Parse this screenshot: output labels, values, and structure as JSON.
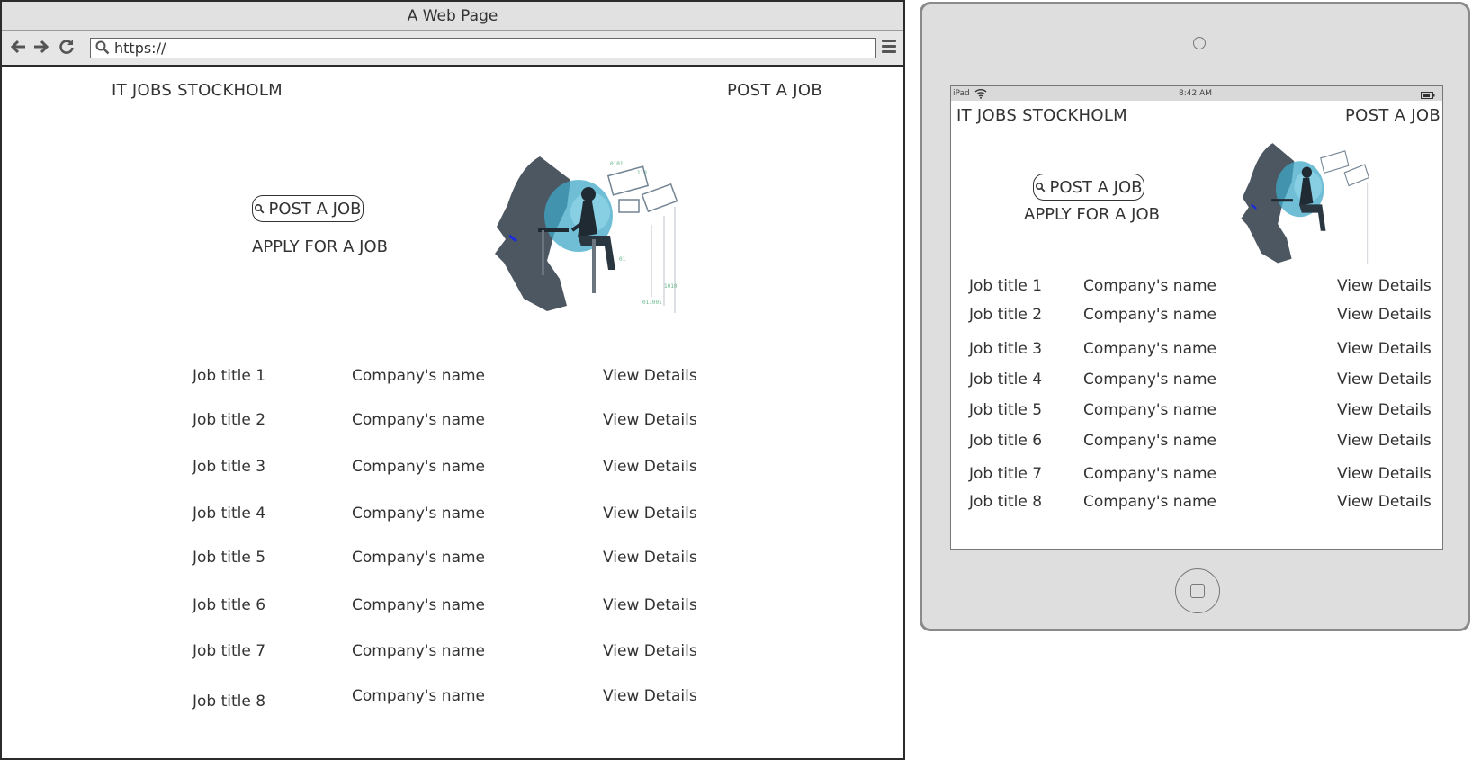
{
  "browser": {
    "window_title": "A Web Page",
    "url": "https://",
    "icons": [
      "back-icon",
      "forward-icon",
      "reload-icon",
      "search-icon",
      "menu-icon"
    ]
  },
  "desktop": {
    "site_title": "IT JOBS STOCKHOLM",
    "nav_post_job": "POST A JOB",
    "hero_post_button": "POST A JOB",
    "hero_apply_link": "APPLY FOR A JOB",
    "jobs": [
      {
        "title": "Job title 1",
        "company": "Company's name",
        "action": "View Details"
      },
      {
        "title": "Job title 2",
        "company": "Company's name",
        "action": "View Details"
      },
      {
        "title": "Job title 3",
        "company": "Company's name",
        "action": "View Details"
      },
      {
        "title": "Job title 4",
        "company": "Company's name",
        "action": "View Details"
      },
      {
        "title": "Job title 5",
        "company": "Company's name",
        "action": "View Details"
      },
      {
        "title": "Job title 6",
        "company": "Company's name",
        "action": "View Details"
      },
      {
        "title": "Job title 7",
        "company": "Company's name",
        "action": "View Details"
      },
      {
        "title": "Job title 8",
        "company": "Company's name",
        "action": "View Details"
      }
    ]
  },
  "ipad": {
    "status_device": "iPad",
    "status_time": "8:42 AM",
    "site_title": "IT JOBS STOCKHOLM",
    "nav_post_job": "POST A JOB",
    "hero_post_button": "POST A JOB",
    "hero_apply_link": "APPLY FOR A JOB",
    "jobs": [
      {
        "title": "Job title 1",
        "company": "Company's name",
        "action": "View Details"
      },
      {
        "title": "Job title 2",
        "company": "Company's name",
        "action": "View Details"
      },
      {
        "title": "Job title 3",
        "company": "Company's name",
        "action": "View Details"
      },
      {
        "title": "Job title 4",
        "company": "Company's name",
        "action": "View Details"
      },
      {
        "title": "Job title 5",
        "company": "Company's name",
        "action": "View Details"
      },
      {
        "title": "Job title 6",
        "company": "Company's name",
        "action": "View Details"
      },
      {
        "title": "Job title 7",
        "company": "Company's name",
        "action": "View Details"
      },
      {
        "title": "Job title 8",
        "company": "Company's name",
        "action": "View Details"
      }
    ]
  },
  "colors": {
    "frame_border": "#2b2b2b",
    "chrome_gray": "#e1e1e1",
    "device_gray": "#dedede",
    "text": "#333333",
    "illustration_accent": "#3fa8c8"
  }
}
